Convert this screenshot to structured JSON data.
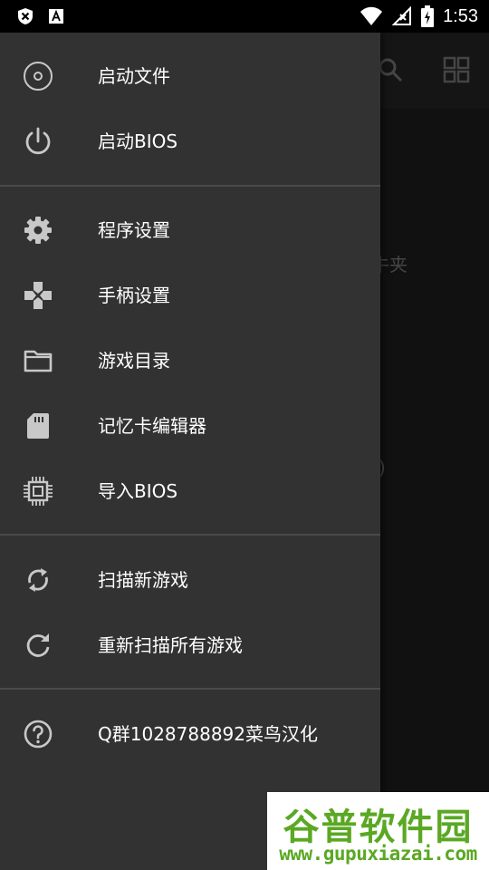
{
  "status_bar": {
    "time": "1:53",
    "icons": [
      "x-shield-icon",
      "a-box-icon",
      "wifi-icon",
      "signal-icon",
      "battery-charging-icon"
    ]
  },
  "background": {
    "toolbar_icons": [
      "search-icon",
      "grid-view-icon"
    ],
    "partial_text_1": "牛夹",
    "partial_text_2": ")"
  },
  "drawer": {
    "sections": [
      {
        "items": [
          {
            "name": "boot-file",
            "icon": "disc-icon",
            "label": "启动文件"
          },
          {
            "name": "boot-bios",
            "icon": "power-icon",
            "label": "启动BIOS"
          }
        ]
      },
      {
        "items": [
          {
            "name": "app-settings",
            "icon": "gear-icon",
            "label": "程序设置"
          },
          {
            "name": "controller-settings",
            "icon": "gamepad-icon",
            "label": "手柄设置"
          },
          {
            "name": "game-directory",
            "icon": "folder-icon",
            "label": "游戏目录"
          },
          {
            "name": "memory-card-editor",
            "icon": "sd-card-icon",
            "label": "记忆卡编辑器"
          },
          {
            "name": "import-bios",
            "icon": "chip-icon",
            "label": "导入BIOS"
          }
        ]
      },
      {
        "items": [
          {
            "name": "scan-new-games",
            "icon": "sync-icon",
            "label": "扫描新游戏"
          },
          {
            "name": "rescan-all-games",
            "icon": "refresh-icon",
            "label": "重新扫描所有游戏"
          }
        ]
      },
      {
        "items": [
          {
            "name": "qq-group",
            "icon": "help-icon",
            "label": "Q群1028788892菜鸟汉化"
          }
        ]
      }
    ]
  },
  "watermark": {
    "brand": "谷普软件园",
    "url": "www.gupuxiazai.com"
  },
  "colors": {
    "drawer_bg": "#323232",
    "icon": "#c8c8c8",
    "divider": "#4a4a4a",
    "watermark_green": "#5aa823"
  }
}
